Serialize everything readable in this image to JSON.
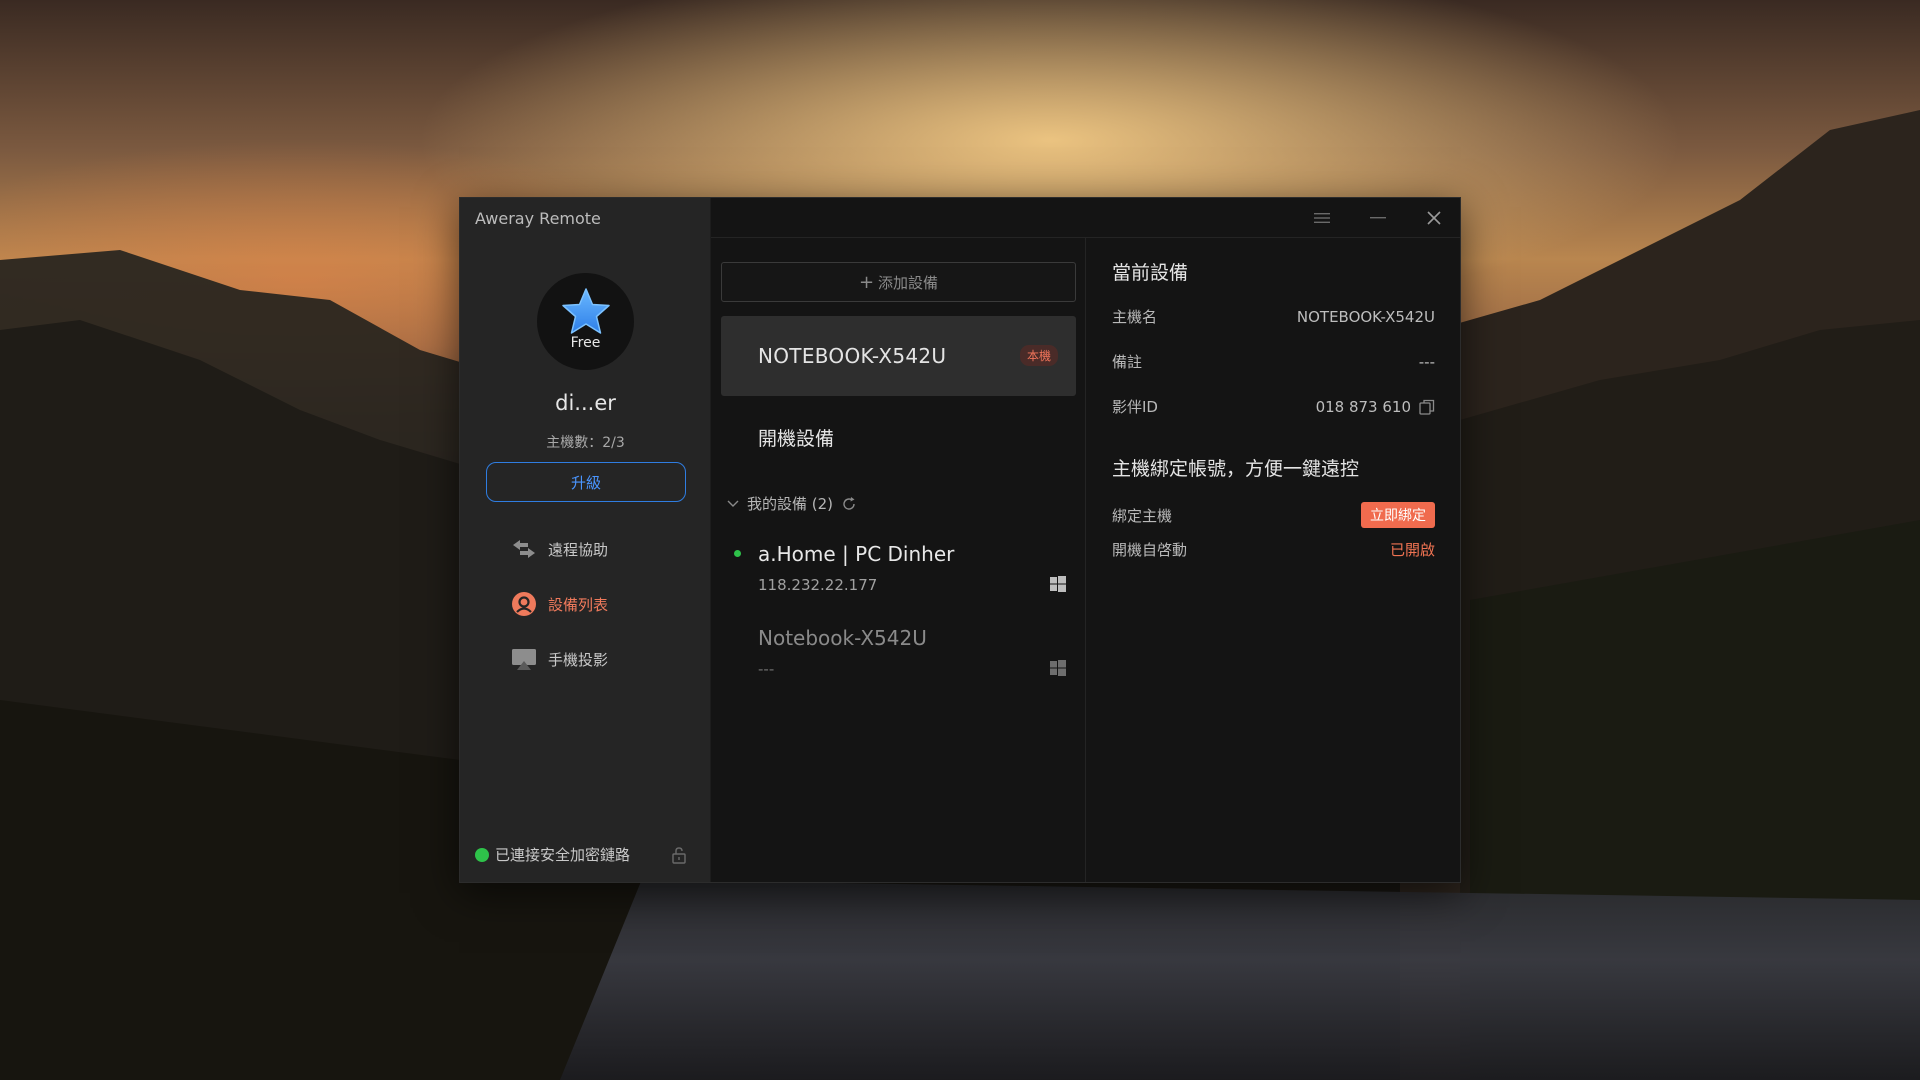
{
  "app": {
    "title": "Aweray Remote"
  },
  "profile": {
    "plan": "Free",
    "user_name": "di...er",
    "host_count": "主機數：2/3",
    "upgrade_label": "升級"
  },
  "nav": {
    "items": [
      {
        "label": "遠程協助",
        "icon": "remote-assist-icon",
        "active": false
      },
      {
        "label": "設備列表",
        "icon": "device-list-icon",
        "active": true
      },
      {
        "label": "手機投影",
        "icon": "screen-mirror-icon",
        "active": false
      }
    ]
  },
  "status": {
    "secure_text": "已連接安全加密鏈路",
    "color": "#2ec24a"
  },
  "devices": {
    "add_label": "添加設備",
    "local": {
      "name": "NOTEBOOK-X542U",
      "badge": "本機"
    },
    "online_title": "開機設備",
    "group": {
      "label": "我的設備 (2)"
    },
    "list": [
      {
        "name": "a.Home | PC Dinher",
        "ip": "118.232.22.177",
        "online": true,
        "os_icon": "windows-icon"
      },
      {
        "name": "Notebook-X542U",
        "ip": "---",
        "online": false,
        "os_icon": "windows-icon"
      }
    ]
  },
  "detail": {
    "title": "當前設備",
    "host_name_label": "主機名",
    "host_name_value": "NOTEBOOK-X542U",
    "note_label": "備註",
    "note_value": "---",
    "id_label": "影伴ID",
    "id_value": "018 873 610",
    "bind_title": "主機綁定帳號，方便一鍵遠控",
    "bind_label": "綁定主機",
    "bind_button": "立即綁定",
    "autostart_label": "開機自啓動",
    "autostart_value": "已開啟"
  },
  "colors": {
    "accent": "#2f7de1",
    "active": "#ef7a5c",
    "bind": "#f06b4e"
  }
}
